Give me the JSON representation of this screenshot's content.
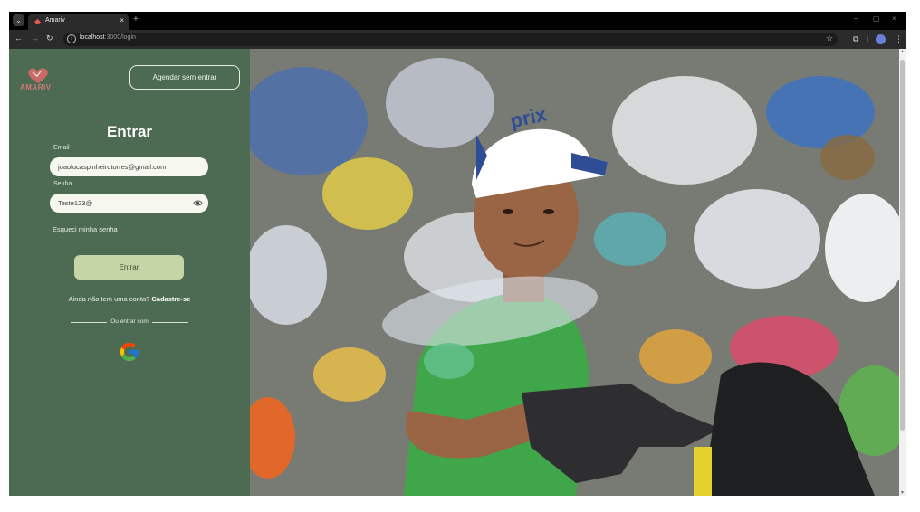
{
  "browser": {
    "tab_title": "Amariv",
    "tab_close": "×",
    "new_tab": "+",
    "url_host": "localhost",
    "url_path": ":3000/login",
    "window_controls": {
      "minimize": "–",
      "maximize": "▢",
      "close": "×"
    }
  },
  "brand": {
    "logo_text": "AMARIV",
    "logo_color": "#cf7a78"
  },
  "header": {
    "guest_button": "Agendar sem entrar"
  },
  "login": {
    "title": "Entrar",
    "email_label": "Email",
    "email_value": "joaolucaspinheirotorres@gmail.com",
    "password_label": "Senha",
    "password_value": "Teste123@",
    "forgot_password": "Esqueci minha senha",
    "submit_button": "Entrar",
    "signup_prompt": "Ainda não tem uma conta?",
    "signup_link": "Cadastre-se",
    "divider_text": "Ou entrar com",
    "social_provider_icon": "google-icon"
  },
  "hero": {
    "cap_text": "prix",
    "description_icon": "recycling-worker-photo"
  },
  "colors": {
    "panel_bg": "#4d6b52",
    "input_bg": "#f6f7ee",
    "submit_bg": "#c5d5a6",
    "shirt_green": "#3fa64a"
  }
}
